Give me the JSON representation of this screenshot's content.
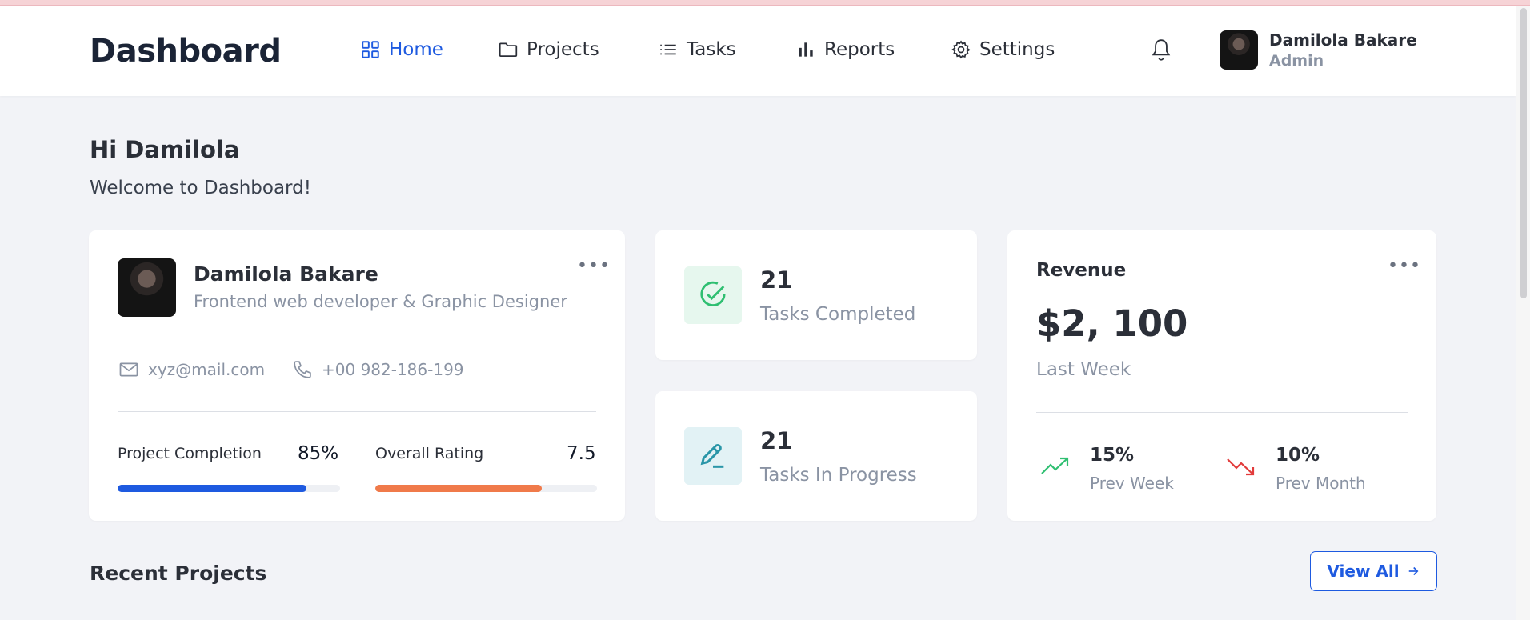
{
  "header": {
    "brand": "Dashboard",
    "nav": [
      {
        "label": "Home",
        "active": true,
        "icon": "grid-icon"
      },
      {
        "label": "Projects",
        "active": false,
        "icon": "folder-icon"
      },
      {
        "label": "Tasks",
        "active": false,
        "icon": "list-icon"
      },
      {
        "label": "Reports",
        "active": false,
        "icon": "bar-chart-icon"
      },
      {
        "label": "Settings",
        "active": false,
        "icon": "gear-icon"
      }
    ],
    "user": {
      "name": "Damilola Bakare",
      "role": "Admin"
    }
  },
  "greeting": {
    "title": "Hi Damilola",
    "subtitle": "Welcome to Dashboard!"
  },
  "profile": {
    "name": "Damilola Bakare",
    "role": "Frontend web developer & Graphic Designer",
    "email": "xyz@mail.com",
    "phone": "+00 982-186-199",
    "completion": {
      "label": "Project Completion",
      "value": "85%",
      "fraction": 0.85
    },
    "rating": {
      "label": "Overall Rating",
      "value": "7.5",
      "fraction": 0.75
    }
  },
  "tasks": {
    "completed": {
      "count": "21",
      "label": "Tasks Completed"
    },
    "in_progress": {
      "count": "21",
      "label": "Tasks In Progress"
    }
  },
  "revenue": {
    "title": "Revenue",
    "amount": "$2, 100",
    "period": "Last Week",
    "prev_week": {
      "pct": "15%",
      "label": "Prev Week",
      "direction": "up"
    },
    "prev_month": {
      "pct": "10%",
      "label": "Prev Month",
      "direction": "down"
    }
  },
  "recent_projects": {
    "title": "Recent Projects",
    "view_all": "View All"
  },
  "colors": {
    "accent": "#1e5ae0",
    "rating_bar": "#f07a4a",
    "success": "#2fbf71",
    "danger": "#e23b3b",
    "completed_bg": "#e6f7ee",
    "progress_bg": "#e2f2f5"
  }
}
